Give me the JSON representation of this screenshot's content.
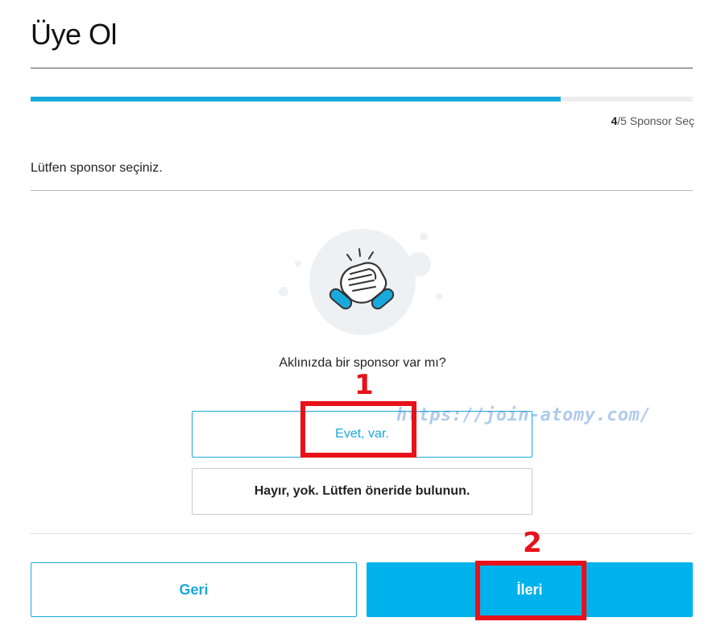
{
  "page": {
    "title": "Üye Ol"
  },
  "progress": {
    "fraction": 0.8,
    "current_step": "4",
    "step_rest": "/5 Sponsor Seç"
  },
  "instruction": "Lütfen sponsor seçiniz.",
  "question": "Aklınızda bir sponsor var mı?",
  "options": {
    "yes_label": "Evet, var.",
    "no_label": "Hayır, yok. Lütfen öneride bulunun."
  },
  "footer": {
    "back_label": "Geri",
    "next_label": "İleri"
  },
  "annotations": {
    "marker_1": "1",
    "marker_2": "2",
    "color": "#e8111a"
  },
  "watermark": "https://join-atomy.com/",
  "colors": {
    "accent": "#1aa9dd",
    "button_fill": "#00b2ec"
  },
  "icons": {
    "illustration": "handshake-icon"
  }
}
